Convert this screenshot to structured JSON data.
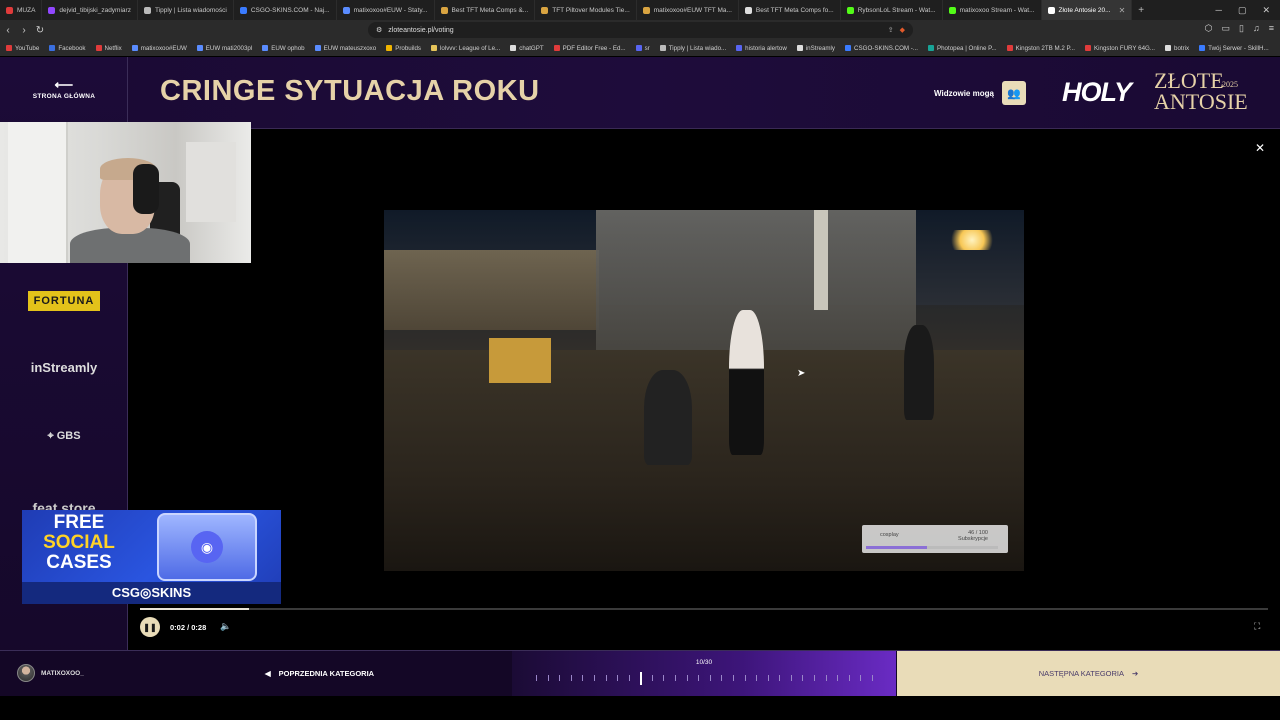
{
  "browser": {
    "tabs": [
      {
        "label": "MUZA",
        "color": "#e03b3b"
      },
      {
        "label": "dejvid_tibijski_zadymiarz",
        "color": "#9147ff"
      },
      {
        "label": "Tipply | Lista wiadomości",
        "color": "#bbbbbb"
      },
      {
        "label": "CSGO-SKINS.COM - Naj...",
        "color": "#3a7bff"
      },
      {
        "label": "matixoxoo#EUW - Staty...",
        "color": "#5a8cff"
      },
      {
        "label": "Best TFT Meta Comps &...",
        "color": "#d9a441"
      },
      {
        "label": "TFT Piltover Modules Tie...",
        "color": "#d9a441"
      },
      {
        "label": "matixoxoo#EUW TFT Ma...",
        "color": "#d9a441"
      },
      {
        "label": "Best TFT Meta Comps fo...",
        "color": "#dddddd"
      },
      {
        "label": "RybsonLoL Stream - Wat...",
        "color": "#53fc18"
      },
      {
        "label": "matixoxoo Stream - Wat...",
        "color": "#53fc18"
      },
      {
        "label": "Złote Antosie 20...",
        "color": "#ffffff",
        "active": true
      }
    ],
    "url": "zloteantosie.pl/voting",
    "bookmarks": [
      {
        "label": "YouTube",
        "color": "#e03b3b"
      },
      {
        "label": "Facebook",
        "color": "#3a6fe0"
      },
      {
        "label": "Netflix",
        "color": "#e03b3b"
      },
      {
        "label": "matixoxoo#EUW",
        "color": "#5a8cff"
      },
      {
        "label": "EUW mati2003pl",
        "color": "#5a8cff"
      },
      {
        "label": "EUW ophob",
        "color": "#5a8cff"
      },
      {
        "label": "EUW mateuszxoxo",
        "color": "#5a8cff"
      },
      {
        "label": "Probuilds",
        "color": "#f0b400"
      },
      {
        "label": "lolvvv: League of Le...",
        "color": "#e6c45a"
      },
      {
        "label": "chatGPT",
        "color": "#dddddd"
      },
      {
        "label": "PDF Editor Free - Ed...",
        "color": "#e03b3b"
      },
      {
        "label": "sr",
        "color": "#5865f2"
      },
      {
        "label": "Tipply | Lista wiado...",
        "color": "#bbbbbb"
      },
      {
        "label": "historia alertow",
        "color": "#5865f2"
      },
      {
        "label": "inStreamly",
        "color": "#dddddd"
      },
      {
        "label": "CSGO-SKINS.COM -...",
        "color": "#3a7bff"
      },
      {
        "label": "Photopea | Online P...",
        "color": "#18a497"
      },
      {
        "label": "Kingston 2TB M.2 P...",
        "color": "#e03b3b"
      },
      {
        "label": "Kingston FURY 64G...",
        "color": "#e03b3b"
      },
      {
        "label": "botrix",
        "color": "#dddddd"
      },
      {
        "label": "Twój Serwer - SkillH...",
        "color": "#3a7bff"
      }
    ]
  },
  "header": {
    "home_label": "STRONA GŁÓWNA",
    "title": "CRINGE SYTUACJA ROKU",
    "viewers_label": "Widzowie mogą",
    "logo_holy": "HOLY",
    "logo_zlote": "ZŁOTE",
    "logo_antosie": "ANTOSIE",
    "logo_year": "2025"
  },
  "sponsors": {
    "fortuna": "FORTUNA",
    "instreamly": "inStreamly",
    "gbs": "GBS",
    "featstore": "feat.store"
  },
  "promo": {
    "line1": "FREE",
    "line2": "SOCIAL",
    "line3": "CASES",
    "brand": "CSG◎SKINS"
  },
  "video": {
    "tag_name": "cosplay",
    "tag_score": "46 / 100",
    "tag_sub": "Subskrypcje",
    "tag_level": 0.46
  },
  "player": {
    "time": "0:02 / 0:28",
    "progress": 0.097
  },
  "footer": {
    "username": "MATIXOXOO_",
    "prev_label": "POPRZEDNIA KATEGORIA",
    "next_label": "NASTĘPNA KATEGORIA",
    "category_counter": "10/30",
    "category_current": 10,
    "category_total": 30
  }
}
